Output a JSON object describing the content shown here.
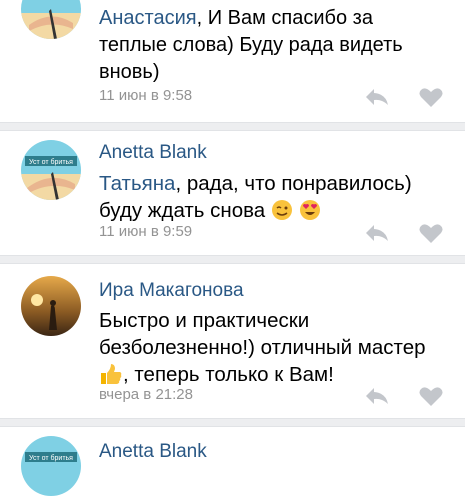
{
  "colors": {
    "link": "#2a5885",
    "muted": "#939393",
    "divider": "#edeef0",
    "icon": "#c3c6cb"
  },
  "comments": [
    {
      "author": "Анастасия",
      "text_after_author": ", И Вам спасибо за теплые слова) Буду рада видеть вновь)",
      "time": "11 июн в 9:58"
    },
    {
      "author": "Anetta Blank",
      "mention": "Татьяна",
      "text": ", рада, что понравилось) буду ждать снова",
      "emojis": [
        "winking-face",
        "heart-eyes-face"
      ],
      "avatar_caption": "Уст от бритья",
      "time": "11 июн в 9:59"
    },
    {
      "author": "Ира Макагонова",
      "text_before_emoji": "Быстро и практически безболезненно!) отличный мастер",
      "emoji": "thumbs-up",
      "text_after_emoji": ", теперь только к Вам!",
      "time": "вчера в 21:28"
    },
    {
      "author": "Anetta Blank",
      "avatar_caption": "Уст от бритья"
    }
  ],
  "icons": {
    "reply": "reply-arrow-icon",
    "like": "heart-icon"
  }
}
